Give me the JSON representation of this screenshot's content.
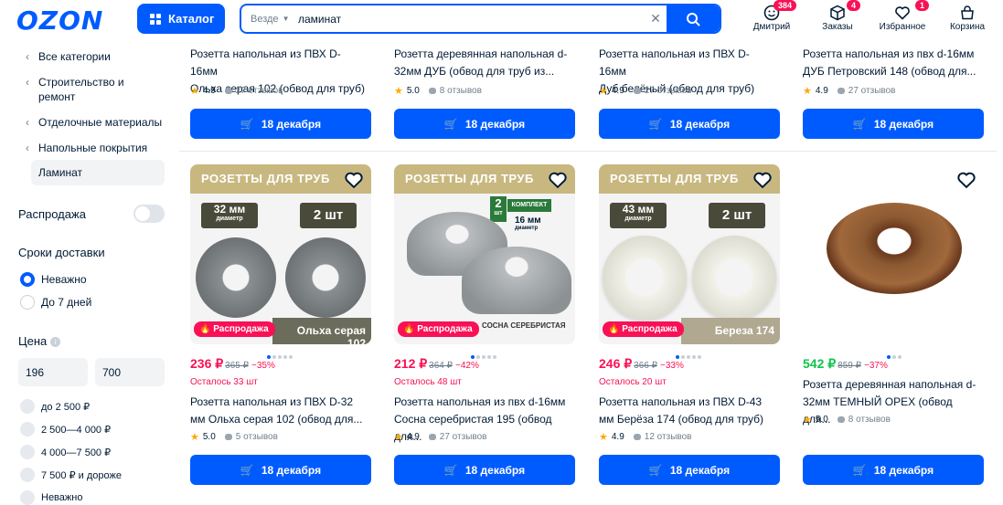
{
  "header": {
    "logo": "OZON",
    "catalog_label": "Каталог",
    "search_scope": "Везде",
    "search_value": "ламинат",
    "user": {
      "label": "Дмитрий",
      "badge": "384"
    },
    "orders": {
      "label": "Заказы",
      "badge": "4"
    },
    "favorites": {
      "label": "Избранное",
      "badge": "1"
    },
    "cart": {
      "label": "Корзина"
    }
  },
  "sidebar": {
    "categories": [
      "Все категории",
      "Строительство и ремонт",
      "Отделочные материалы",
      "Напольные покрытия"
    ],
    "active_category": "Ламинат",
    "sale_label": "Распродажа",
    "delivery_title": "Сроки доставки",
    "delivery_options": [
      "Неважно",
      "До 7 дней"
    ],
    "price_title": "Цена",
    "price_from": "196",
    "price_to": "700",
    "price_ranges": [
      "до 2 500 ₽",
      "2 500—4 000 ₽",
      "4 000—7 500 ₽",
      "7 500 ₽ и дороже",
      "Неважно"
    ]
  },
  "top_row": [
    {
      "title": [
        "Розетта напольная из ПВХ D-16мм",
        "Ольха серая 102 (обвод для труб)"
      ],
      "rating": "4.9",
      "reviews": "27 отзывов",
      "button": "18 декабря"
    },
    {
      "title": [
        "Розетта деревянная напольная d-",
        "32мм ДУБ (обвод для труб из..."
      ],
      "rating": "5.0",
      "reviews": "8 отзывов",
      "button": "18 декабря"
    },
    {
      "title": [
        "Розетта напольная из ПВХ D-16мм",
        "Дуб белёный (обвод для труб)"
      ],
      "rating": "4.9",
      "reviews": "27 отзывов",
      "button": "18 декабря"
    },
    {
      "title": [
        "Розетта напольная из пвх d-16мм",
        "ДУБ Петровский 148 (обвод для..."
      ],
      "rating": "4.9",
      "reviews": "27 отзывов",
      "button": "18 декабря"
    }
  ],
  "products": [
    {
      "banner": "РОЗЕТТЫ ДЛЯ ТРУБ",
      "tag1": "32 мм",
      "tag1_sub": "диаметр",
      "tag2": "2 шт",
      "caption": "Ольха серая 102",
      "promo": "Распродажа",
      "price": "236 ₽",
      "old_price": "365 ₽",
      "discount": "−35%",
      "left": "Осталось 33 шт",
      "title": [
        "Розетта напольная из ПВХ D-32",
        "мм Ольха серая 102 (обвод для..."
      ],
      "rating": "5.0",
      "reviews": "5 отзывов",
      "button": "18 декабря"
    },
    {
      "banner": "РОЗЕТТЫ ДЛЯ ТРУБ",
      "tag1": "2",
      "tag1_sub": "шт",
      "tag2": "КОМПЛЕКТ",
      "tag3": "16 мм",
      "tag3_sub": "диаметр",
      "caption": "СОСНА СЕРЕБРИСТАЯ",
      "promo": "Распродажа",
      "price": "212 ₽",
      "old_price": "364 ₽",
      "discount": "−42%",
      "left": "Осталось 48 шт",
      "title": [
        "Розетта напольная из пвх d-16мм",
        "Сосна серебристая 195 (обвод для..."
      ],
      "rating": "4.9",
      "reviews": "27 отзывов",
      "button": "18 декабря"
    },
    {
      "banner": "РОЗЕТТЫ ДЛЯ ТРУБ",
      "tag1": "43 мм",
      "tag1_sub": "диаметр",
      "tag2": "2 шт",
      "caption": "Береза 174",
      "promo": "Распродажа",
      "price": "246 ₽",
      "old_price": "366 ₽",
      "discount": "−33%",
      "left": "Осталось 20 шт",
      "title": [
        "Розетта напольная из ПВХ D-43",
        "мм Берёза 174 (обвод для труб)"
      ],
      "rating": "4.9",
      "reviews": "12 отзывов",
      "button": "18 декабря"
    },
    {
      "price": "542 ₽",
      "old_price": "859 ₽",
      "discount": "−37%",
      "title": [
        "Розетта деревянная напольная d-",
        "32мм ТЕМНЫЙ ОРЕХ (обвод для..."
      ],
      "rating": "5.0",
      "reviews": "8 отзывов",
      "button": "18 декабря"
    }
  ],
  "colors": {
    "brand": "#005bff",
    "sale": "#f91155",
    "green_price": "#10c44c",
    "banner": "#c8b880"
  }
}
